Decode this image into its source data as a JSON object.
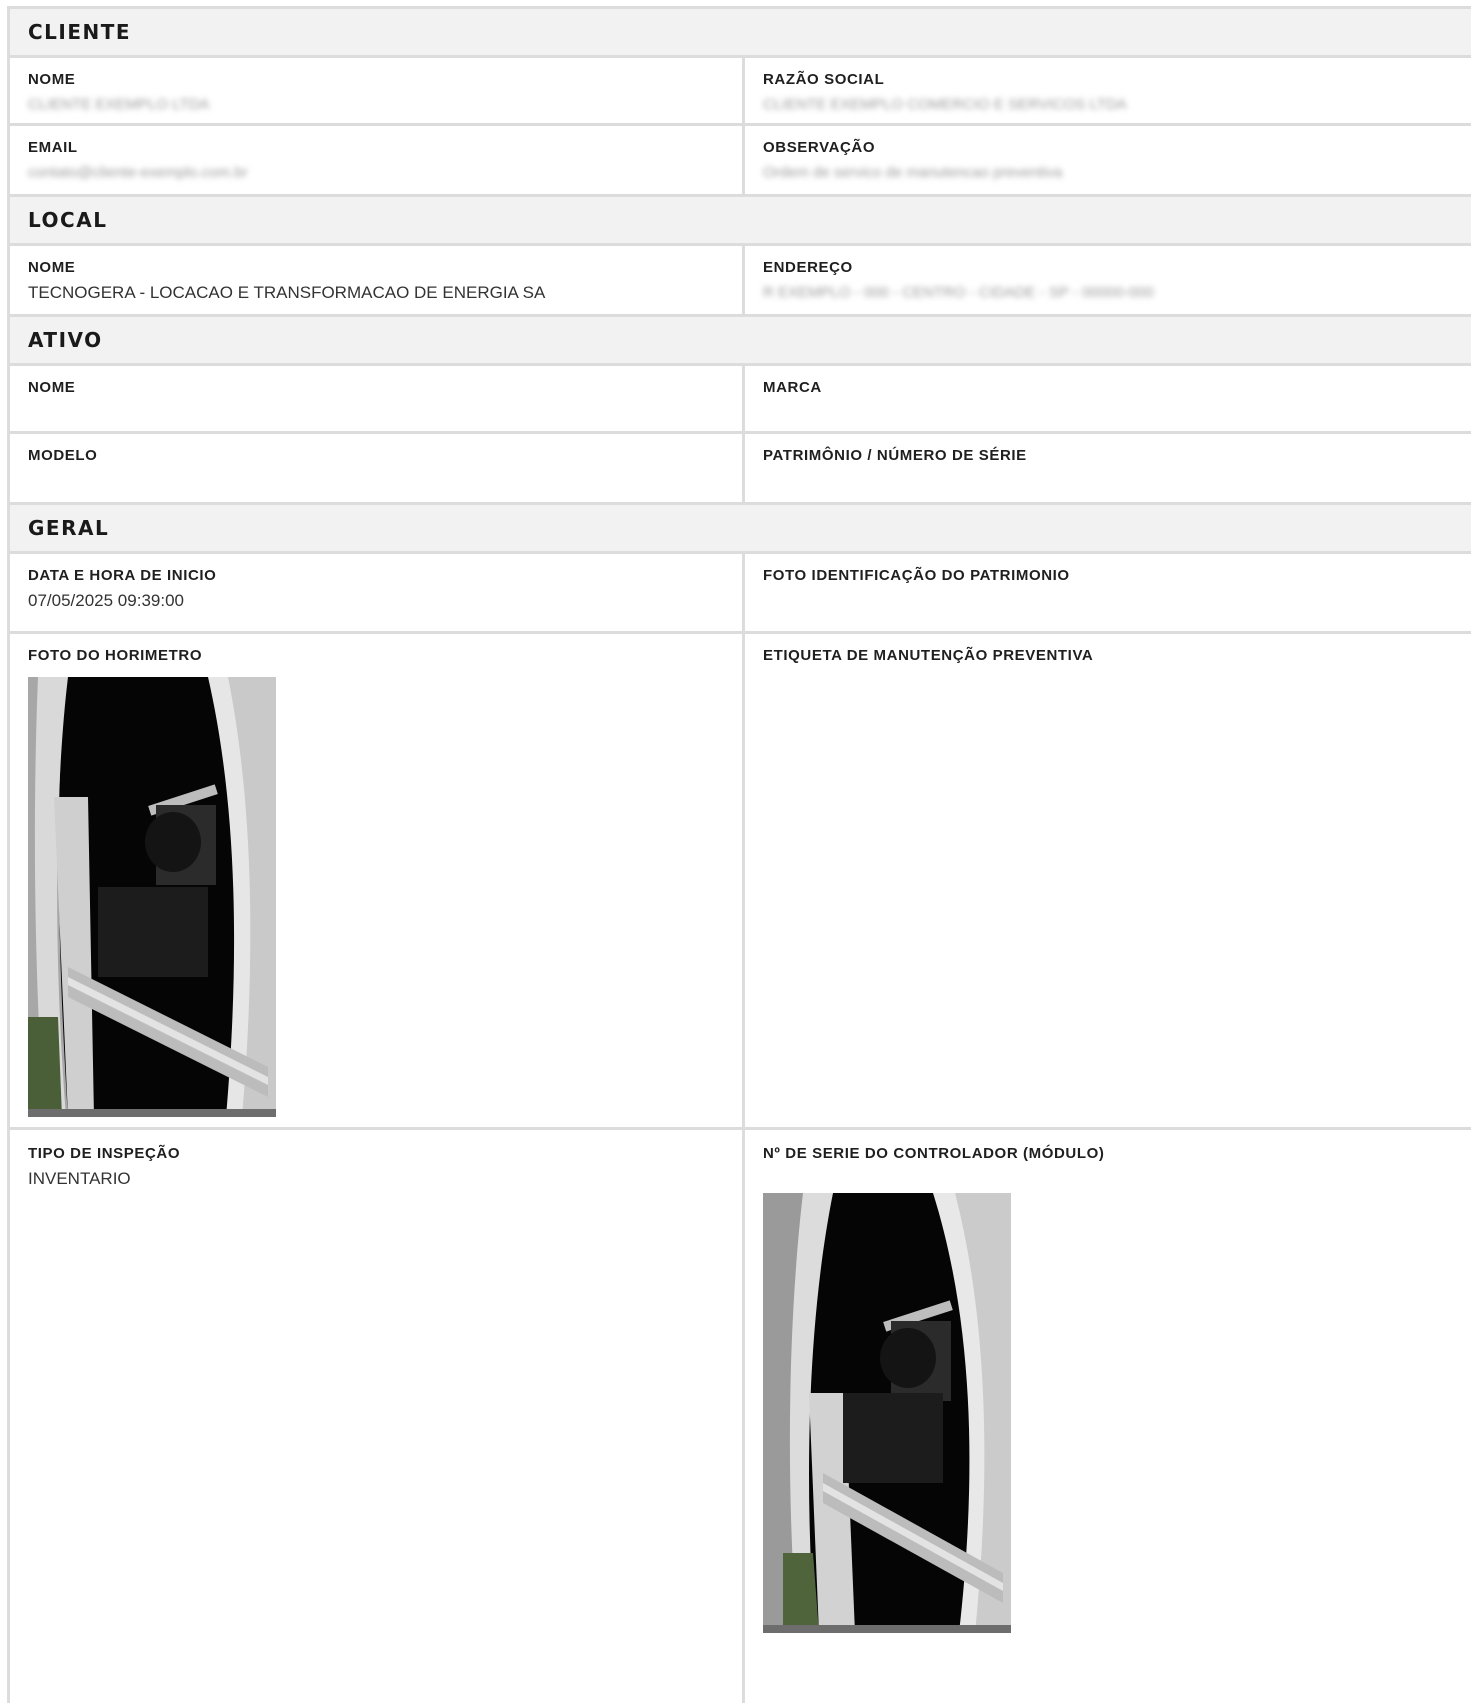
{
  "cliente": {
    "title": "CLIENTE",
    "nome_label": "NOME",
    "nome_value": "CLIENTE EXEMPLO LTDA",
    "razao_label": "RAZÃO SOCIAL",
    "razao_value": "CLIENTE EXEMPLO COMERCIO E SERVICOS LTDA",
    "email_label": "EMAIL",
    "email_value": "contato@cliente-exemplo.com.br",
    "obs_label": "OBSERVAÇÃO",
    "obs_value": "Ordem de servico de manutencao preventiva"
  },
  "local": {
    "title": "LOCAL",
    "nome_label": "NOME",
    "nome_value": "TECNOGERA - LOCACAO E TRANSFORMACAO DE ENERGIA SA",
    "endereco_label": "ENDEREÇO",
    "endereco_value": "R EXEMPLO - 000 - CENTRO - CIDADE - SP - 00000-000"
  },
  "ativo": {
    "title": "ATIVO",
    "nome_label": "NOME",
    "marca_label": "MARCA",
    "modelo_label": "MODELO",
    "patrimonio_label": "PATRIMÔNIO / NÚMERO DE SÉRIE"
  },
  "geral": {
    "title": "GERAL",
    "data_label": "DATA E HORA DE INICIO",
    "data_value": "07/05/2025 09:39:00",
    "foto_id_label": "FOTO IDENTIFICAÇÃO DO PATRIMONIO",
    "foto_horimetro_label": "FOTO DO HORIMETRO",
    "etiqueta_label": "ETIQUETA DE MANUTENÇÃO PREVENTIVA",
    "tipo_label": "TIPO DE INSPEÇÃO",
    "tipo_value": "INVENTARIO",
    "serie_label": "Nº DE SERIE DO CONTROLADOR (MÓDULO)"
  }
}
